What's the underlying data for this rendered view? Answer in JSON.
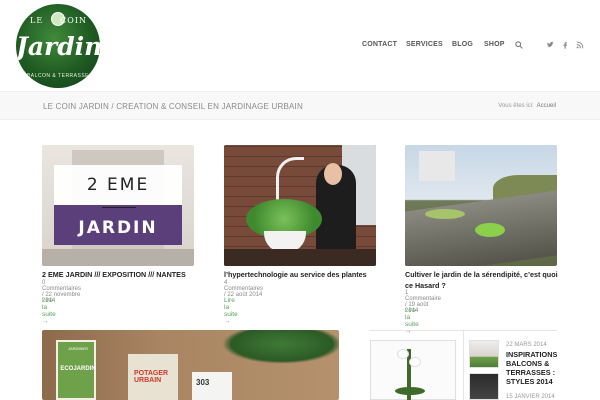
{
  "header": {
    "logo": {
      "le": "LE",
      "coin": "COIN",
      "jardin": "Jardin",
      "sub": "BALCON & TERRASSE"
    },
    "nav": [
      "CONTACT",
      "SERVICES",
      "BLOG",
      "SHOP"
    ],
    "search_icon": "search-icon",
    "social": {
      "twitter": "t",
      "facebook": "f",
      "rss": "rss"
    }
  },
  "titlebar": {
    "title": "LE COIN JARDIN / CREATION & CONSEIL EN JARDINAGE URBAIN",
    "breadcrumb_label": "Vous êtes ici:",
    "breadcrumb_link": "Accueil"
  },
  "posts": [
    {
      "title": "2 EME JARDIN /// EXPOSITION /// NANTES",
      "meta": "0 Commentaires / 22 novembre 2014",
      "more": "Lire la suite →",
      "image_text_top": "2 EME",
      "image_text_bottom": "JARDIN"
    },
    {
      "title": "l’hypertechnologie au service des plantes",
      "meta": "4 Commentaires / 22 août 2014",
      "more": "Lire la suite →"
    },
    {
      "title": "Cultiver le jardin de la sérendipité, c’est quoi ce Hasard ?",
      "meta": "1 Commentaire / 19 août 2014",
      "more": "Lire la suite →"
    }
  ],
  "feature": {
    "book1_title": "ECOJARDIN",
    "book1_sub": "JARDINER",
    "book2_title": "POTAGER URBAIN",
    "book3_title": "303"
  },
  "sidebar": {
    "item1_date": "22 MARS 2014",
    "item1_title": "INSPIRATIONS BALCONS & TERRASSES : STYLES 2014",
    "item2_date": "15 JANVIER 2014"
  }
}
